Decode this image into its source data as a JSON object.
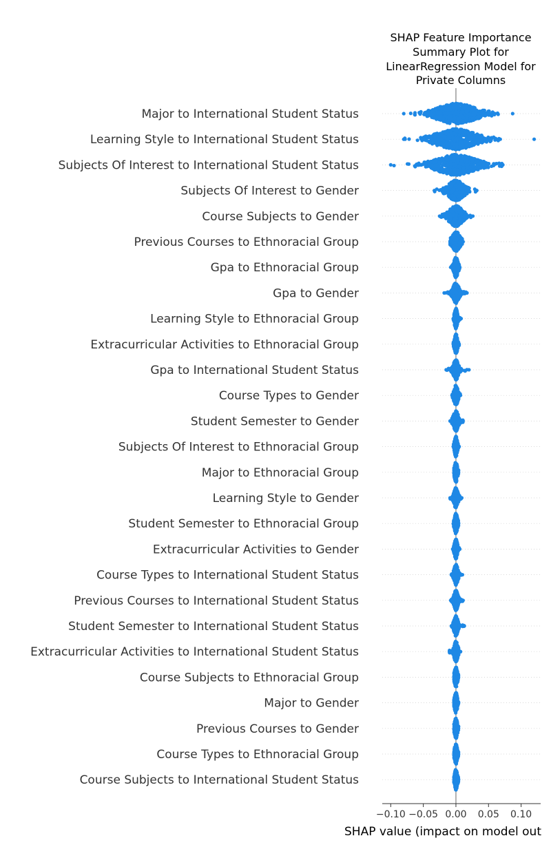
{
  "chart_data": {
    "type": "scatter",
    "subtype": "shap-beeswarm",
    "title_lines": [
      "SHAP Feature Importance",
      "Summary Plot for",
      "LinearRegression Model for",
      "Private Columns"
    ],
    "xlabel": "SHAP value (impact on model out",
    "xlim": [
      -0.113,
      0.13
    ],
    "xticks": [
      -0.1,
      -0.05,
      0.0,
      0.05,
      0.1
    ],
    "xtick_labels": [
      "−0.10",
      "−0.05",
      "0.00",
      "0.05",
      "0.10"
    ],
    "point_color": "#1E88E5",
    "zero_line_color": "#999999",
    "grid": false,
    "features": [
      {
        "name": "Major to International Student Status",
        "min": -0.08,
        "max": 0.087,
        "spread": 0.04
      },
      {
        "name": "Learning Style to International Student Status",
        "min": -0.08,
        "max": 0.068,
        "spread": 0.04,
        "outliers": [
          0.12
        ]
      },
      {
        "name": "Subjects Of Interest to International Student Status",
        "min": -0.1,
        "max": 0.072,
        "spread": 0.04
      },
      {
        "name": "Subjects Of Interest to Gender",
        "min": -0.033,
        "max": 0.032,
        "spread": 0.016
      },
      {
        "name": "Course Subjects to Gender",
        "min": -0.025,
        "max": 0.026,
        "spread": 0.014
      },
      {
        "name": "Previous Courses to Ethnoracial Group",
        "min": -0.009,
        "max": 0.011,
        "spread": 0.008
      },
      {
        "name": "Gpa to Ethnoracial Group",
        "min": -0.008,
        "max": 0.006,
        "spread": 0.004
      },
      {
        "name": "Gpa to Gender",
        "min": -0.018,
        "max": 0.017,
        "spread": 0.006
      },
      {
        "name": "Learning Style to Ethnoracial Group",
        "min": -0.004,
        "max": 0.008,
        "spread": 0.003
      },
      {
        "name": "Extracurricular Activities to Ethnoracial Group",
        "min": -0.004,
        "max": 0.005,
        "spread": 0.003
      },
      {
        "name": "Gpa to International Student Status",
        "min": -0.015,
        "max": 0.02,
        "spread": 0.005
      },
      {
        "name": "Course Types to Gender",
        "min": -0.006,
        "max": 0.007,
        "spread": 0.004
      },
      {
        "name": "Student Semester to Gender",
        "min": -0.009,
        "max": 0.011,
        "spread": 0.005
      },
      {
        "name": "Subjects Of Interest to Ethnoracial Group",
        "min": -0.004,
        "max": 0.005,
        "spread": 0.003
      },
      {
        "name": "Major to Ethnoracial Group",
        "min": -0.003,
        "max": 0.004,
        "spread": 0.003
      },
      {
        "name": "Learning Style to Gender",
        "min": -0.009,
        "max": 0.009,
        "spread": 0.004
      },
      {
        "name": "Student Semester to Ethnoracial Group",
        "min": -0.004,
        "max": 0.004,
        "spread": 0.003
      },
      {
        "name": "Extracurricular Activities to Gender",
        "min": -0.005,
        "max": 0.006,
        "spread": 0.003
      },
      {
        "name": "Course Types to International Student Status",
        "min": -0.007,
        "max": 0.01,
        "spread": 0.004
      },
      {
        "name": "Previous Courses to International Student Status",
        "min": -0.008,
        "max": 0.011,
        "spread": 0.004
      },
      {
        "name": "Student Semester to International Student Status",
        "min": -0.007,
        "max": 0.013,
        "spread": 0.004
      },
      {
        "name": "Extracurricular Activities to International Student Status",
        "min": -0.01,
        "max": 0.007,
        "spread": 0.004
      },
      {
        "name": "Course Subjects to Ethnoracial Group",
        "min": -0.003,
        "max": 0.004,
        "spread": 0.003
      },
      {
        "name": "Major to Gender",
        "min": -0.003,
        "max": 0.004,
        "spread": 0.003
      },
      {
        "name": "Previous Courses to Gender",
        "min": -0.003,
        "max": 0.004,
        "spread": 0.003
      },
      {
        "name": "Course Types to Ethnoracial Group",
        "min": -0.003,
        "max": 0.004,
        "spread": 0.003
      },
      {
        "name": "Course Subjects to International Student Status",
        "min": -0.003,
        "max": 0.004,
        "spread": 0.003
      }
    ]
  }
}
